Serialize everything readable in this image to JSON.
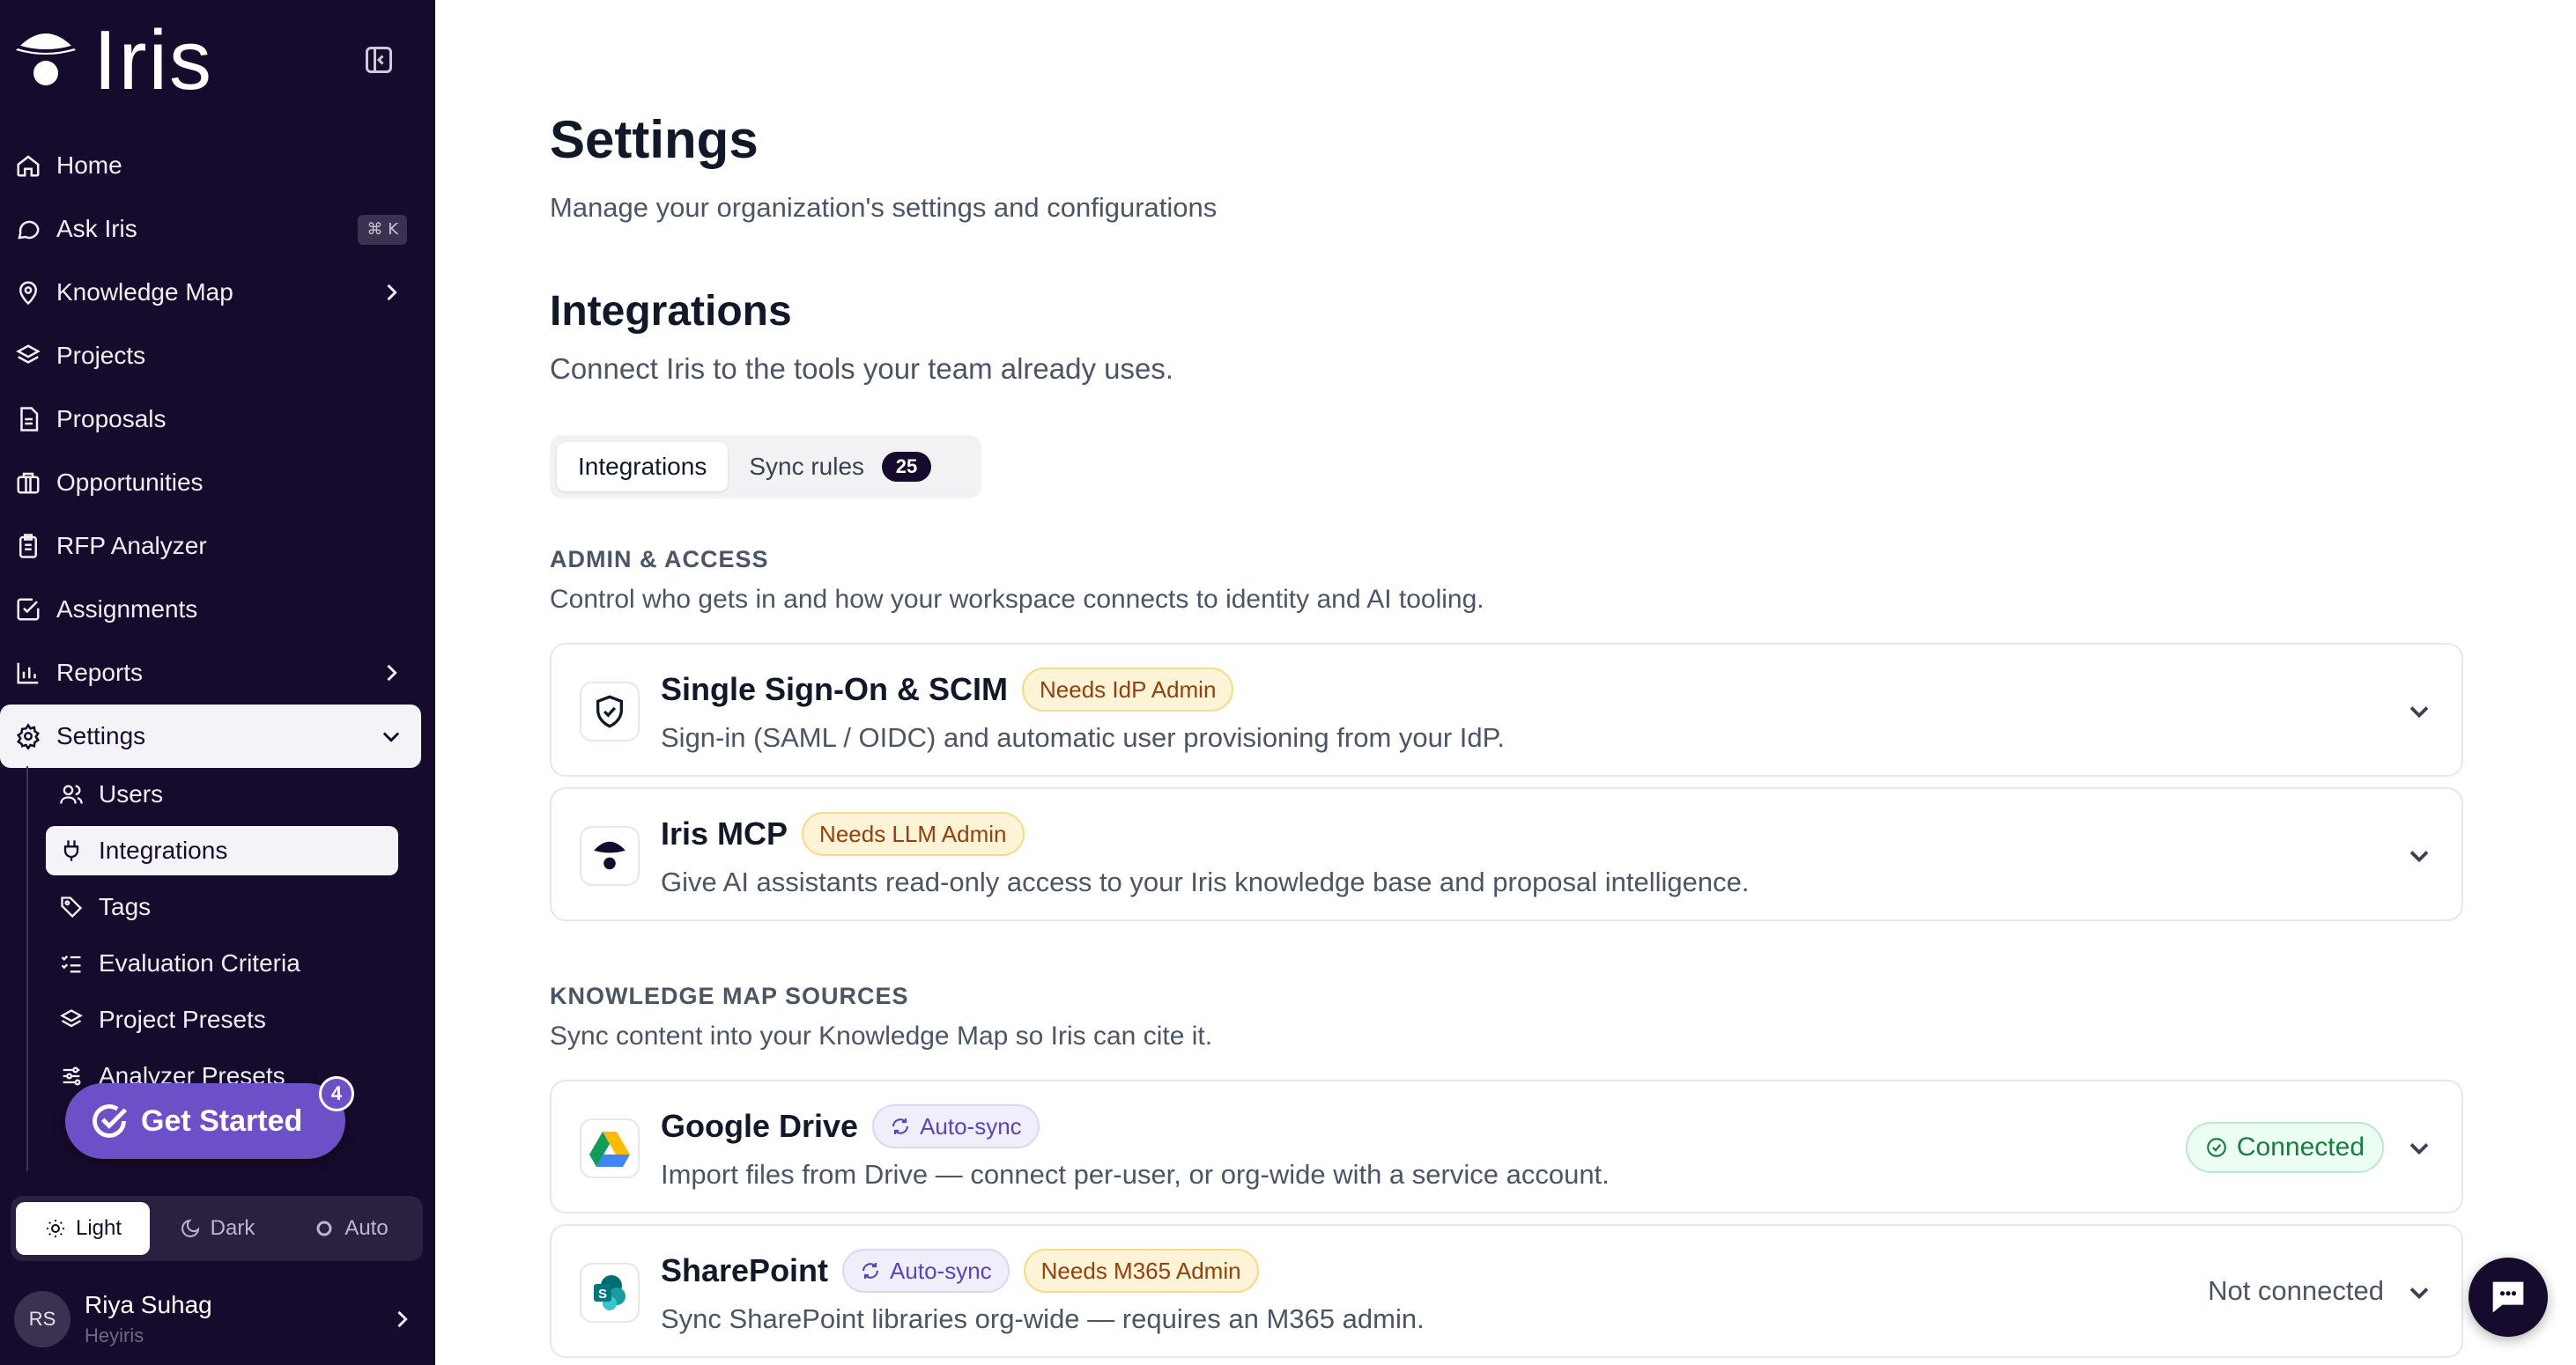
{
  "app": {
    "name": "Iris"
  },
  "sidebar": {
    "items": [
      {
        "label": "Home",
        "icon": "home-icon"
      },
      {
        "label": "Ask Iris",
        "icon": "chat-bubble-icon",
        "shortcut": "⌘ K"
      },
      {
        "label": "Knowledge Map",
        "icon": "map-pin-icon"
      },
      {
        "label": "Projects",
        "icon": "layers-icon"
      },
      {
        "label": "Proposals",
        "icon": "document-icon"
      },
      {
        "label": "Opportunities",
        "icon": "briefcase-icon"
      },
      {
        "label": "RFP Analyzer",
        "icon": "clipboard-icon"
      },
      {
        "label": "Assignments",
        "icon": "checkbox-icon"
      },
      {
        "label": "Reports",
        "icon": "bar-chart-icon"
      },
      {
        "label": "Settings",
        "icon": "gear-icon"
      }
    ],
    "settings_sub": [
      {
        "label": "Users",
        "icon": "users-icon"
      },
      {
        "label": "Integrations",
        "icon": "plug-icon"
      },
      {
        "label": "Tags",
        "icon": "tag-icon"
      },
      {
        "label": "Evaluation Criteria",
        "icon": "list-checks-icon"
      },
      {
        "label": "Project Presets",
        "icon": "layers-icon"
      },
      {
        "label": "Analyzer Presets",
        "icon": "sliders-icon"
      }
    ],
    "get_started": {
      "label": "Get Started",
      "count": "4"
    },
    "theme": {
      "light": "Light",
      "dark": "Dark",
      "auto": "Auto"
    },
    "user": {
      "initials": "RS",
      "name": "Riya Suhag",
      "org": "Heyiris"
    }
  },
  "main": {
    "title": "Settings",
    "subtitle": "Manage your organization's settings and configurations",
    "section_title": "Integrations",
    "section_subtitle": "Connect Iris to the tools your team already uses.",
    "tabs": [
      {
        "label": "Integrations"
      },
      {
        "label": "Sync rules",
        "count": "25"
      }
    ],
    "groups": [
      {
        "label": "ADMIN & ACCESS",
        "description": "Control who gets in and how your workspace connects to identity and AI tooling.",
        "cards": [
          {
            "title": "Single Sign-On & SCIM",
            "badge": "Needs IdP Admin",
            "description": "Sign-in (SAML / OIDC) and automatic user provisioning from your IdP."
          },
          {
            "title": "Iris MCP",
            "badge": "Needs LLM Admin",
            "description": "Give AI assistants read-only access to your Iris knowledge base and proposal intelligence."
          }
        ]
      },
      {
        "label": "KNOWLEDGE MAP SOURCES",
        "description": "Sync content into your Knowledge Map so Iris can cite it.",
        "cards": [
          {
            "title": "Google Drive",
            "sync_badge": "Auto-sync",
            "status": "Connected",
            "description": "Import files from Drive — connect per-user, or org-wide with a service account."
          },
          {
            "title": "SharePoint",
            "sync_badge": "Auto-sync",
            "badge": "Needs M365 Admin",
            "status": "Not connected",
            "description": "Sync SharePoint libraries org-wide — requires an M365 admin."
          }
        ]
      }
    ]
  },
  "colors": {
    "sidebar_bg": "#160b2c",
    "accent": "#6d4fc7",
    "connected": "#15803d",
    "warn_bg": "#fdf3d7"
  }
}
